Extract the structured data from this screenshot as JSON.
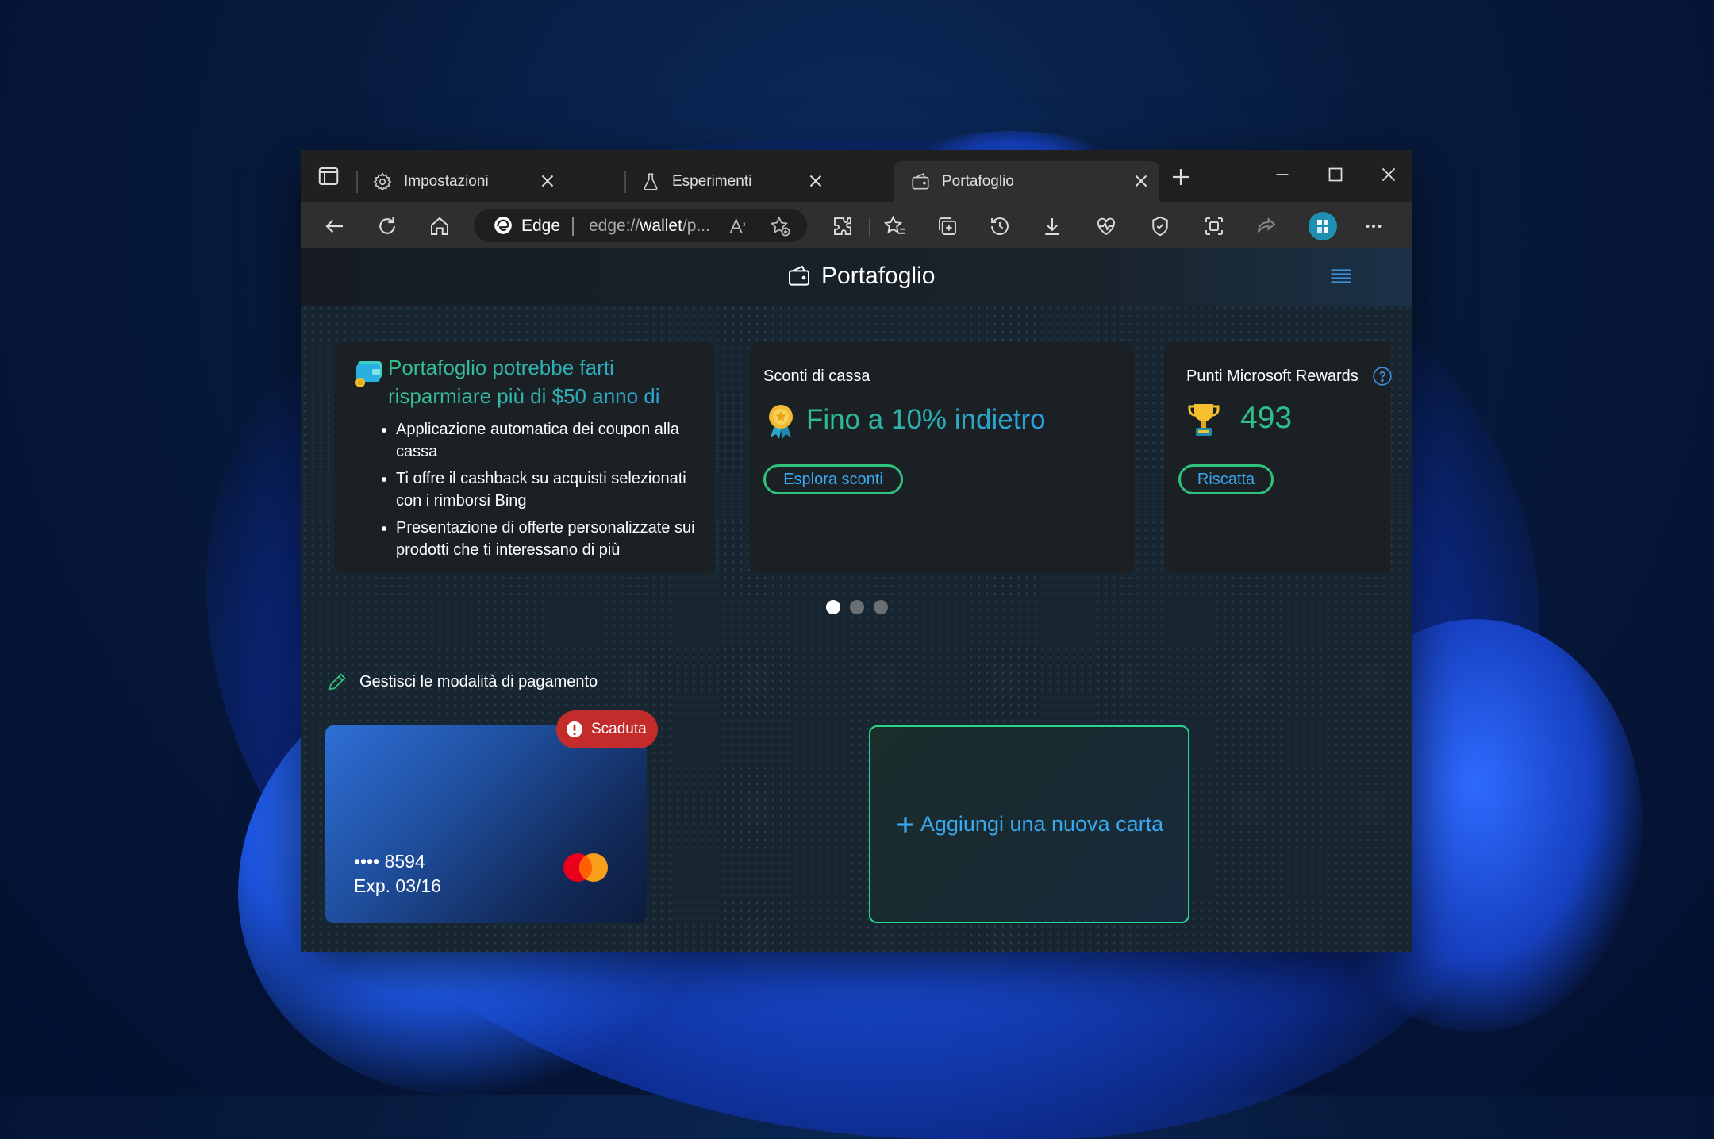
{
  "browser": {
    "tabs": [
      {
        "label": "Impostazioni",
        "icon": "gear-icon"
      },
      {
        "label": "Esperimenti",
        "icon": "flask-icon"
      },
      {
        "label": "Portafoglio",
        "icon": "wallet-icon",
        "active": true
      }
    ],
    "address": {
      "brand": "Edge",
      "url_prefix": "edge://",
      "url_strong": "wallet",
      "url_suffix": "/p..."
    }
  },
  "page": {
    "title": "Portafoglio",
    "promo": {
      "title": "Portafoglio potrebbe farti risparmiare più di $50 anno di",
      "bullets": [
        "Applicazione automatica dei coupon alla cassa",
        "Ti offre il cashback su acquisti selezionati con i rimborsi Bing",
        "Presentazione di offerte personalizzate sui prodotti che ti interessano di più"
      ]
    },
    "discounts": {
      "heading": "Sconti di cassa",
      "value": "Fino a 10% indietro",
      "button": "Esplora sconti"
    },
    "rewards": {
      "heading": "Punti Microsoft Rewards",
      "points": "493",
      "button": "Riscatta"
    },
    "carousel": {
      "count": 3,
      "active": 0
    },
    "payments": {
      "heading": "Gestisci le modalità di pagamento",
      "card": {
        "masked": "•••• 8594",
        "expiry": "Exp. 03/16",
        "status": "Scaduta",
        "network": "mastercard"
      },
      "add_card": "Aggiungi una nuova carta"
    }
  },
  "colors": {
    "accent_green": "#2ec27e",
    "accent_blue": "#3aa8ee",
    "expired_red": "#c42b2b"
  }
}
